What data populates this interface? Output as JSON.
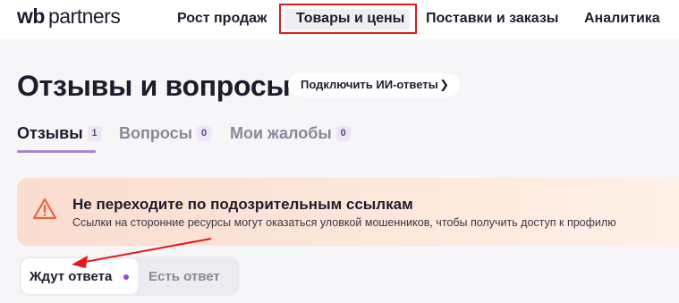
{
  "header": {
    "logo_wb": "wb",
    "logo_partners": "partners",
    "nav": [
      {
        "label": "Рост продаж"
      },
      {
        "label": "Товары и цены"
      },
      {
        "label": "Поставки и заказы"
      },
      {
        "label": "Аналитика"
      }
    ]
  },
  "page": {
    "title": "Отзывы и вопросы",
    "ai_button_label": "Подключить ИИ-ответы",
    "ai_button_icon": "chevron-right-icon"
  },
  "tabs": [
    {
      "label": "Отзывы",
      "count": "1"
    },
    {
      "label": "Вопросы",
      "count": "0"
    },
    {
      "label": "Мои жалобы",
      "count": "0"
    }
  ],
  "alert": {
    "icon": "warning-icon",
    "title": "Не переходите по подозрительным ссылкам",
    "text": "Ссылки на сторонние ресурсы могут оказаться уловкой мошенников, чтобы получить доступ к профилю"
  },
  "filter": {
    "options": [
      {
        "label": "Ждут ответа"
      },
      {
        "label": "Есть ответ"
      }
    ]
  },
  "colors": {
    "annotation": "#e3191c",
    "accent": "#9a45d6",
    "alert_bg": "#fbdcd0"
  }
}
